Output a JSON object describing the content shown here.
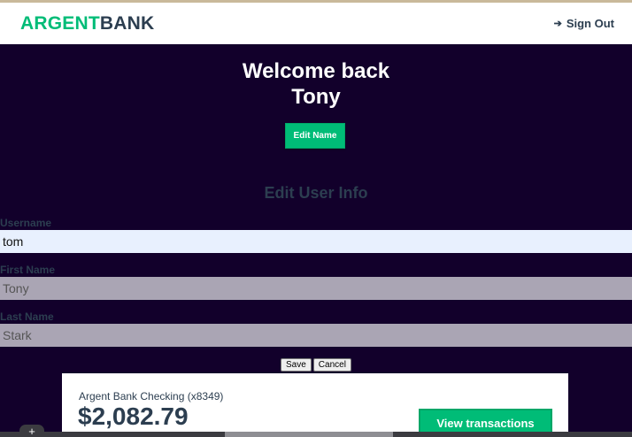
{
  "header": {
    "logo_part1": "ARGENT",
    "logo_part2": "BANK",
    "signout_icon": "sign-out-icon",
    "signout_label": "Sign Out"
  },
  "welcome": {
    "line1": "Welcome back",
    "line2": "Tony",
    "edit_button": "Edit Name"
  },
  "edit_form": {
    "title": "Edit User Info",
    "username_label": "Username",
    "username_value": "tom",
    "firstname_label": "First Name",
    "firstname_value": "Tony",
    "lastname_label": "Last Name",
    "lastname_value": "Stark",
    "save_label": "Save",
    "cancel_label": "Cancel"
  },
  "account": {
    "title": "Argent Bank Checking (x8349)",
    "amount": "$2,082.79",
    "view_button": "View transactions"
  },
  "colors": {
    "brand_green": "#00bc77",
    "background": "#12002b",
    "text_dark": "#2c3e50"
  }
}
